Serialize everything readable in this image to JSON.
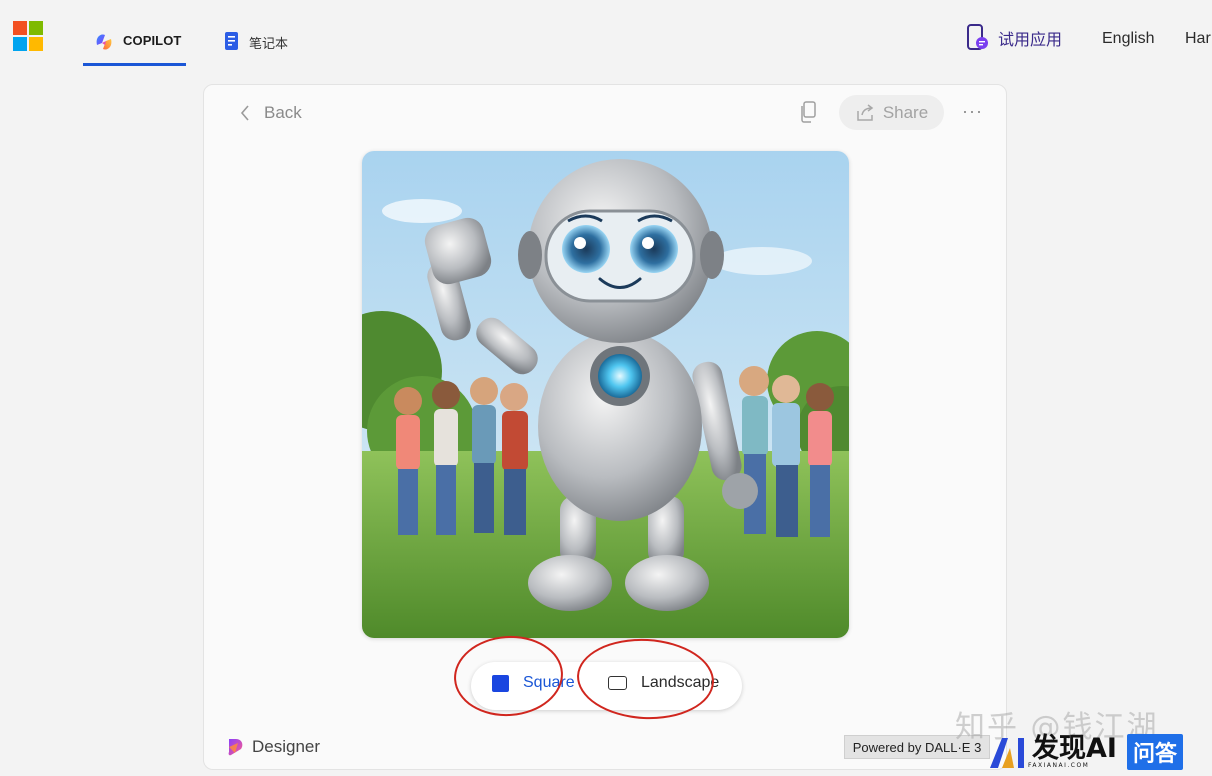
{
  "header": {
    "tabs": [
      {
        "label": "COPILOT",
        "active": true,
        "icon": "copilot-icon"
      },
      {
        "label": "笔记本",
        "active": false,
        "icon": "notebook-icon"
      }
    ],
    "try_app_label": "试用应用",
    "language_label": "English",
    "truncated_nav_label": "Har"
  },
  "card": {
    "back_label": "Back",
    "share_label": "Share",
    "more_label": "···",
    "image": {
      "subject": "waving-robot-with-kids-in-meadow"
    },
    "aspect_options": [
      {
        "label": "Square",
        "selected": true
      },
      {
        "label": "Landscape",
        "selected": false
      }
    ],
    "designer_label": "Designer",
    "powered_label": "Powered by DALL·E 3"
  },
  "watermarks": {
    "zhihu": "知乎 @钱江湖",
    "brand": "发现AI",
    "brand_sub": "FAXIANAI.COM",
    "qa": "问答"
  },
  "colors": {
    "accent": "#1a56d6",
    "annotation": "#d0261e",
    "try_app": "#3a2a8a"
  }
}
